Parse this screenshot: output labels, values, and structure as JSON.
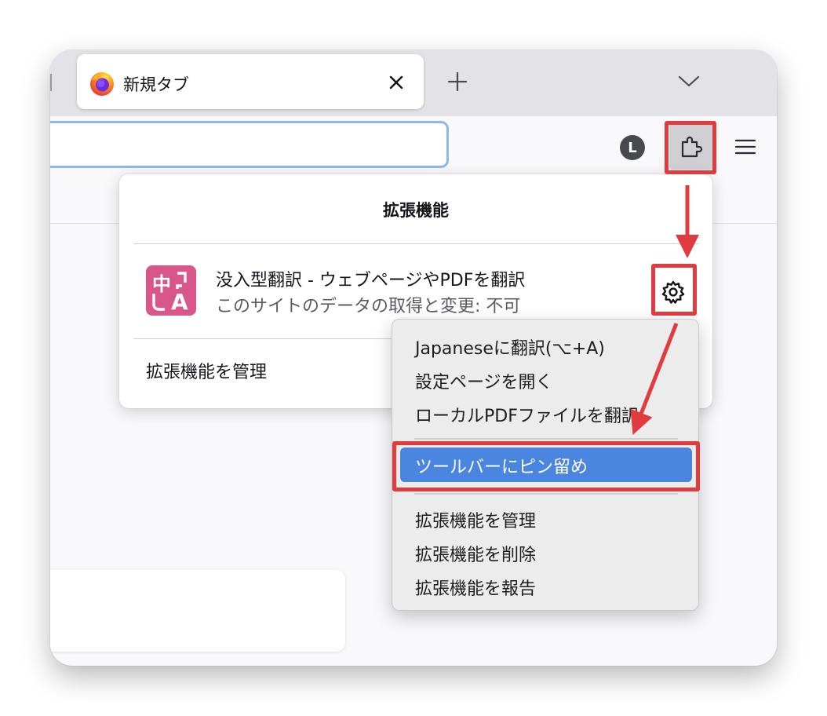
{
  "tabs": {
    "active_title": "新規タブ",
    "icons": {
      "browser": "firefox-icon",
      "close": "close-icon",
      "new_tab": "plus-icon",
      "tab_list": "chevron-down-icon"
    }
  },
  "toolbar": {
    "account_initial": "L",
    "icons": {
      "extensions": "puzzle-piece-icon",
      "menu": "hamburger-menu-icon"
    }
  },
  "extensions_panel": {
    "title": "拡張機能",
    "extension": {
      "name": "没入型翻訳 - ウェブページやPDFを翻訳",
      "permission": "このサイトのデータの取得と変更: 不可",
      "icon_text_top": "中",
      "icon_text_bottom": "A",
      "icon_color": "#d8568a",
      "settings_icon": "gear-icon"
    },
    "manage_label": "拡張機能を管理"
  },
  "context_menu": {
    "items_top": [
      "Japaneseに翻訳(⌥+A)",
      "設定ページを開く",
      "ローカルPDFファイルを翻訳"
    ],
    "selected_item": "ツールバーにピン留め",
    "items_bottom": [
      "拡張機能を管理",
      "拡張機能を削除",
      "拡張機能を報告"
    ],
    "selected_color": "#4a86e0"
  },
  "annotations": {
    "highlight_color": "#e03c3f"
  }
}
